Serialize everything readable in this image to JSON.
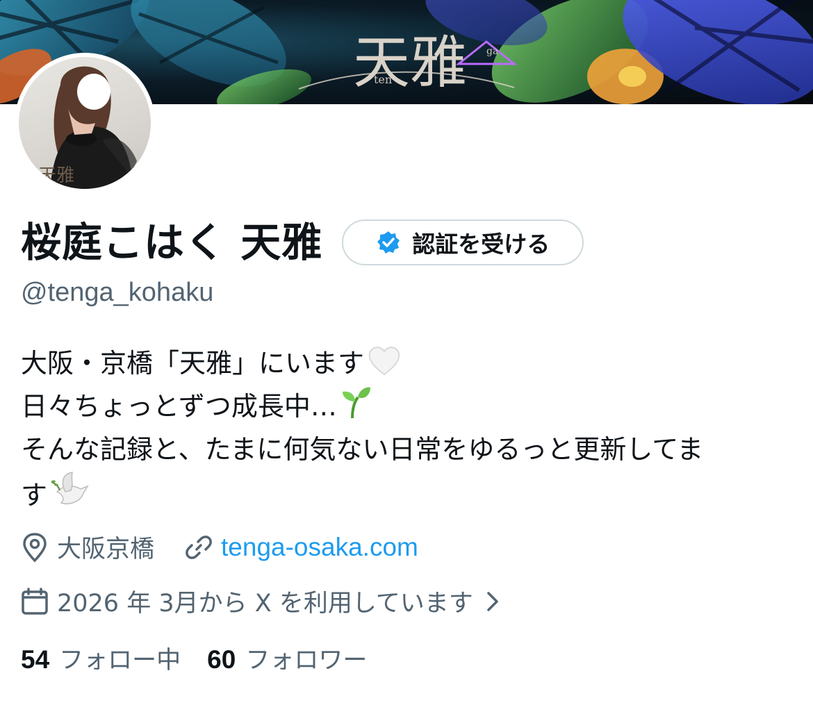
{
  "banner": {
    "logo_text": "天雅",
    "logo_romaji": "ten",
    "logo_romaji_2": "ga"
  },
  "avatar": {
    "watermark": "天雅"
  },
  "profile": {
    "display_name": "桜庭こはく 天雅",
    "verify_button_label": "認証を受ける",
    "handle": "@tenga_kohaku",
    "bio_lines": [
      "大阪・京橋「天雅」にいます",
      "日々ちょっとずつ成長中…",
      "そんな記録と、たまに何気ない日常をゆるっと更新してま",
      "す"
    ],
    "bio_emojis": [
      "white-heart",
      "seedling",
      "dove"
    ],
    "location": "大阪京橋",
    "website": "tenga-osaka.com",
    "joined": "2026 年 3月から X を利用しています"
  },
  "stats": {
    "following_count": "54",
    "following_label": "フォロー中",
    "followers_count": "60",
    "followers_label": "フォロワー"
  },
  "colors": {
    "text": "#0f1419",
    "secondary": "#536471",
    "link": "#1d9bf0",
    "verified": "#1d9bf0",
    "border": "#cfd9de"
  },
  "icons": [
    "location-pin-icon",
    "link-icon",
    "calendar-icon",
    "chevron-right-icon",
    "verified-badge-icon"
  ]
}
